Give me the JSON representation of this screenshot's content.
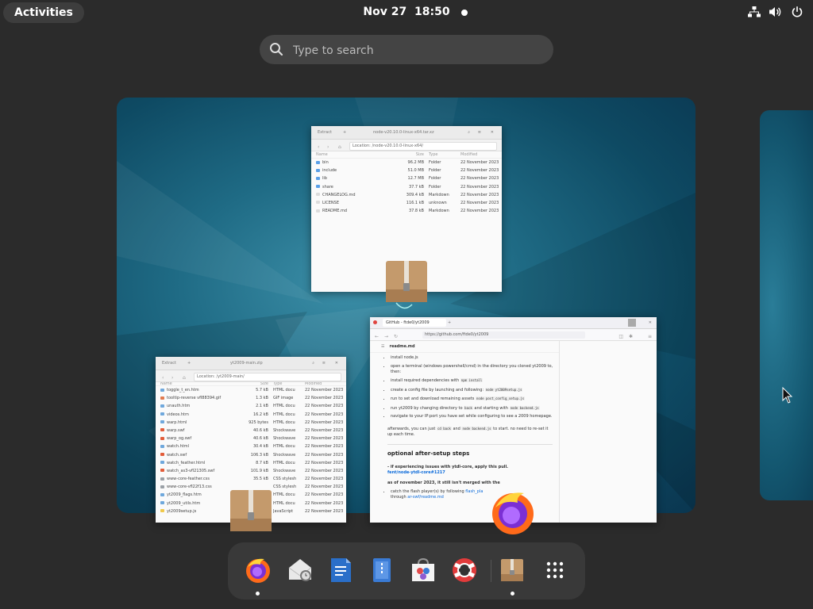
{
  "topbar": {
    "activities_label": "Activities",
    "date": "Nov 27",
    "time": "18:50"
  },
  "search": {
    "placeholder": "Type to search"
  },
  "windows": {
    "file_roller_node": {
      "extract_label": "Extract",
      "title": "node-v20.10.0-linux-x64.tar.xz",
      "location_label": "Location:",
      "path": "/node-v20.10.0-linux-x64/",
      "columns": [
        "Name",
        "Size",
        "Type",
        "Modified"
      ],
      "rows": [
        {
          "name": "bin",
          "size": "96.2 MB",
          "type": "Folder",
          "modified": "22 November 2023",
          "kind": "folder"
        },
        {
          "name": "include",
          "size": "51.0 MB",
          "type": "Folder",
          "modified": "22 November 2023",
          "kind": "folder"
        },
        {
          "name": "lib",
          "size": "12.7 MB",
          "type": "Folder",
          "modified": "22 November 2023",
          "kind": "folder"
        },
        {
          "name": "share",
          "size": "37.7 kB",
          "type": "Folder",
          "modified": "22 November 2023",
          "kind": "folder"
        },
        {
          "name": "CHANGELOG.md",
          "size": "309.4 kB",
          "type": "Markdown",
          "modified": "22 November 2023",
          "kind": "file"
        },
        {
          "name": "LICENSE",
          "size": "116.1 kB",
          "type": "unknown",
          "modified": "22 November 2023",
          "kind": "file"
        },
        {
          "name": "README.md",
          "size": "37.8 kB",
          "type": "Markdown",
          "modified": "22 November 2023",
          "kind": "file"
        }
      ]
    },
    "file_roller_yt": {
      "extract_label": "Extract",
      "title": "yt2009-main.zip",
      "location_label": "Location:",
      "path": "/yt2009-main/",
      "columns": [
        "Name",
        "Size",
        "Type",
        "Modified"
      ],
      "rows": [
        {
          "name": "toggle_t_en.htm",
          "size": "5.7 kB",
          "type": "HTML docu",
          "modified": "22 November 2023",
          "kind": "html"
        },
        {
          "name": "tooltip-reverse vfl88394.gif",
          "size": "1.3 kB",
          "type": "GIF image",
          "modified": "22 November 2023",
          "kind": "gif"
        },
        {
          "name": "unauth.htm",
          "size": "2.1 kB",
          "type": "HTML docu",
          "modified": "22 November 2023",
          "kind": "html"
        },
        {
          "name": "videos.htm",
          "size": "16.2 kB",
          "type": "HTML docu",
          "modified": "22 November 2023",
          "kind": "html"
        },
        {
          "name": "warp.html",
          "size": "925 bytes",
          "type": "HTML docu",
          "modified": "22 November 2023",
          "kind": "html"
        },
        {
          "name": "warp.swf",
          "size": "40.6 kB",
          "type": "Shockwave",
          "modified": "22 November 2023",
          "kind": "swf"
        },
        {
          "name": "warp_og.swf",
          "size": "40.6 kB",
          "type": "Shockwave",
          "modified": "22 November 2023",
          "kind": "swf"
        },
        {
          "name": "watch.html",
          "size": "30.4 kB",
          "type": "HTML docu",
          "modified": "22 November 2023",
          "kind": "html"
        },
        {
          "name": "watch.swf",
          "size": "106.3 kB",
          "type": "Shockwave",
          "modified": "22 November 2023",
          "kind": "swf"
        },
        {
          "name": "watch_feather.html",
          "size": "8.7 kB",
          "type": "HTML docu",
          "modified": "22 November 2023",
          "kind": "html"
        },
        {
          "name": "watch_as3-vfl21305.swf",
          "size": "101.9 kB",
          "type": "Shockwave",
          "modified": "22 November 2023",
          "kind": "swf"
        },
        {
          "name": "www-core-feather.css",
          "size": "35.5 kB",
          "type": "CSS stylesh",
          "modified": "22 November 2023",
          "kind": "css"
        },
        {
          "name": "www-core-vfl22f13.css",
          "size": "",
          "type": "CSS stylesh",
          "modified": "22 November 2023",
          "kind": "css"
        },
        {
          "name": "yt2009_flags.htm",
          "size": "",
          "type": "HTML docu",
          "modified": "22 November 2023",
          "kind": "html"
        },
        {
          "name": "yt2009_utils.htm",
          "size": "",
          "type": "HTML docu",
          "modified": "22 November 2023",
          "kind": "html"
        },
        {
          "name": "yt2009setup.js",
          "size": "",
          "type": "JavaScript",
          "modified": "22 November 2023",
          "kind": "js"
        }
      ]
    },
    "firefox": {
      "tab_title": "GitHub - ftde0/yt2009",
      "url_host": "github.com",
      "url": "https://github.com/ftde0/yt2009",
      "readme_label": "readme.md",
      "steps": [
        {
          "text": "install node.js"
        },
        {
          "text": "open a terminal (windows powershell/cmd) in the directory you cloned yt2009 to, then:"
        },
        {
          "text": "install required dependencies with",
          "code": "npm install"
        },
        {
          "text": "create a config file by launching and following:",
          "code": "node yt2009setup.js"
        },
        {
          "text": "run to set and download remaining assets",
          "code": "node post_config_setup.js"
        },
        {
          "text": "run yt2009 by changing directory to",
          "code": "back",
          "text2": "and starting with",
          "code2": "node backend.js"
        },
        {
          "text": "navigate to your IP:port you have set while configuring to see a 2009 homepage."
        }
      ],
      "afterwards_1": "afterwards, you can just",
      "afterwards_code1": "cd back",
      "afterwards_2": "and",
      "afterwards_code2": "node backend.js",
      "afterwards_3": "to start. no need to re-set it up each time.",
      "heading": "optional after-setup steps",
      "bullet_bold": "- if experiencing issues with ytdl-core, apply this pull.",
      "bullet_link": "fent/node-ytdl-core#1217",
      "sub_bold": "as of november 2023, it still isn't merged with the",
      "sub_item_1": "catch the flash player(s) by following",
      "sub_item_link": "flash_pla",
      "sub_item_2": "through",
      "sub_item_link2": "ar-swf/readme.md"
    }
  },
  "dash": {
    "apps": [
      {
        "name": "Firefox",
        "icon": "firefox-icon",
        "running": true
      },
      {
        "name": "Mail",
        "icon": "mail-icon",
        "running": false
      },
      {
        "name": "Writer",
        "icon": "writer-icon",
        "running": false
      },
      {
        "name": "Text Editor",
        "icon": "text-editor-icon",
        "running": false
      },
      {
        "name": "Software",
        "icon": "software-icon",
        "running": false
      },
      {
        "name": "Help",
        "icon": "help-icon",
        "running": false
      },
      {
        "name": "Archive Manager",
        "icon": "archive-manager-icon",
        "running": true
      },
      {
        "name": "Show Apps",
        "icon": "app-grid-icon",
        "running": false
      }
    ]
  },
  "colors": {
    "panel": "#2b2b2b",
    "dash_bg": "#393939",
    "search_bg": "#444444",
    "workspace_accent": "#1f6b85",
    "link": "#0969da"
  }
}
